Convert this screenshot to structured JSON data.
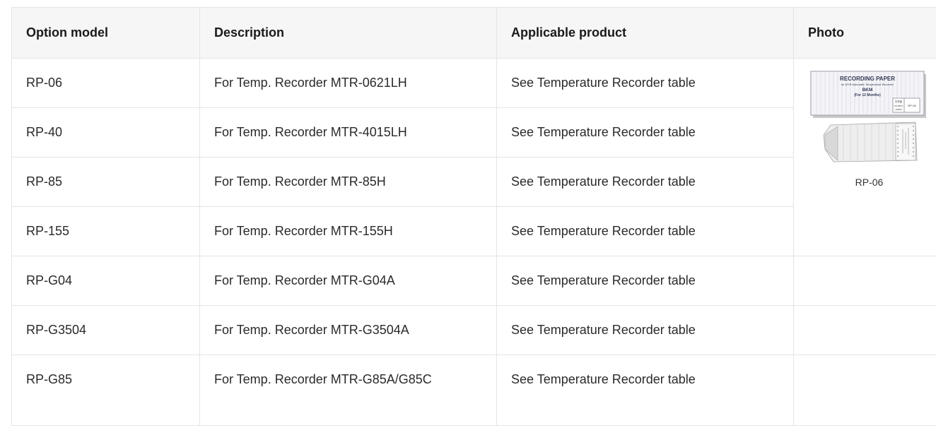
{
  "table": {
    "headers": {
      "model": "Option model",
      "description": "Description",
      "product": "Applicable product",
      "photo": "Photo"
    },
    "rows": [
      {
        "model": "RP-06",
        "description": "For Temp. Recorder MTR-0621LH",
        "product": "See Temperature Recorder table"
      },
      {
        "model": "RP-40",
        "description": "For Temp. Recorder MTR-4015LH",
        "product": "See Temperature Recorder table"
      },
      {
        "model": "RP-85",
        "description": "For Temp. Recorder MTR-85H",
        "product": "See Temperature Recorder table"
      },
      {
        "model": "RP-155",
        "description": "For Temp. Recorder MTR-155H",
        "product": "See Temperature Recorder table"
      },
      {
        "model": "RP-G04",
        "description": "For Temp. Recorder MTR-G04A",
        "product": "See Temperature Recorder table"
      },
      {
        "model": "RP-G3504",
        "description": "For Temp. Recorder MTR-G3504A",
        "product": "See Temperature Recorder table"
      },
      {
        "model": "RP-G85",
        "description": "For Temp. Recorder MTR-G85A/G85C",
        "product": "See Temperature Recorder table"
      }
    ],
    "photo": {
      "caption": "RP-06",
      "box_title": "RECORDING PAPER",
      "box_subtitle": "for MTR Automatic Temperature Recorder",
      "box_model": "BKM",
      "box_period": "(For 12 Months)",
      "box_label": "RP-06",
      "box_origin": "日本製",
      "box_qty": "OUTBOX",
      "box_country": "JAPAN"
    }
  }
}
